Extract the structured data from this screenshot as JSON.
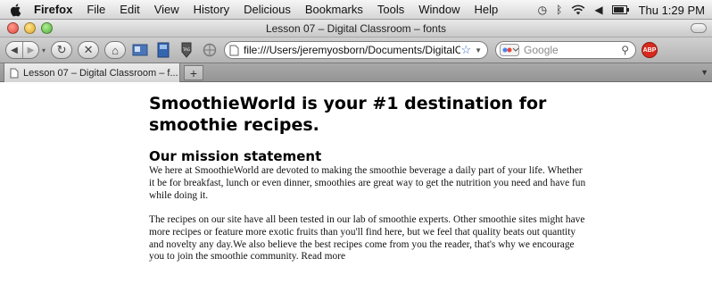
{
  "menubar": {
    "app_name": "Firefox",
    "items": [
      "File",
      "Edit",
      "View",
      "History",
      "Delicious",
      "Bookmarks",
      "Tools",
      "Window",
      "Help"
    ],
    "clock": "Thu 1:29 PM"
  },
  "window": {
    "title": "Lesson 07 – Digital Classroom – fonts"
  },
  "toolbar": {
    "url": "file:///Users/jeremyosborn/Documents/DigitalClas",
    "search_placeholder": "Google",
    "adblock_label": "ABP"
  },
  "tabs": [
    {
      "label": "Lesson 07 – Digital Classroom – f..."
    }
  ],
  "page": {
    "heading": "SmoothieWorld is your #1 destination for smoothie recipes.",
    "mission_heading": "Our mission statement",
    "paragraph1": "We here at SmoothieWorld are devoted to making the smoothie beverage a daily part of your life. Whether it be for breakfast, lunch or even dinner, smoothies are great way to get the nutrition you need and have fun while doing it.",
    "paragraph2": "The recipes on our site have all been tested in our lab of smoothie experts. Other smoothie sites might have more recipes or feature more exotic fruits than you'll find here, but we feel that quality beats out quantity and novelty any day.We also believe the best recipes come from you the reader, that's why we encourage you to join the smoothie community. Read more"
  },
  "colors": {
    "close": "#e2453a",
    "minimize": "#e0a72a",
    "zoom": "#4fae37",
    "adblock": "#d72b20"
  },
  "icons": [
    "apple-icon",
    "back-icon",
    "forward-icon",
    "reload-icon",
    "stop-icon",
    "home-icon",
    "bookmark-icon",
    "search-icon",
    "wifi-icon",
    "volume-icon",
    "battery-icon"
  ]
}
